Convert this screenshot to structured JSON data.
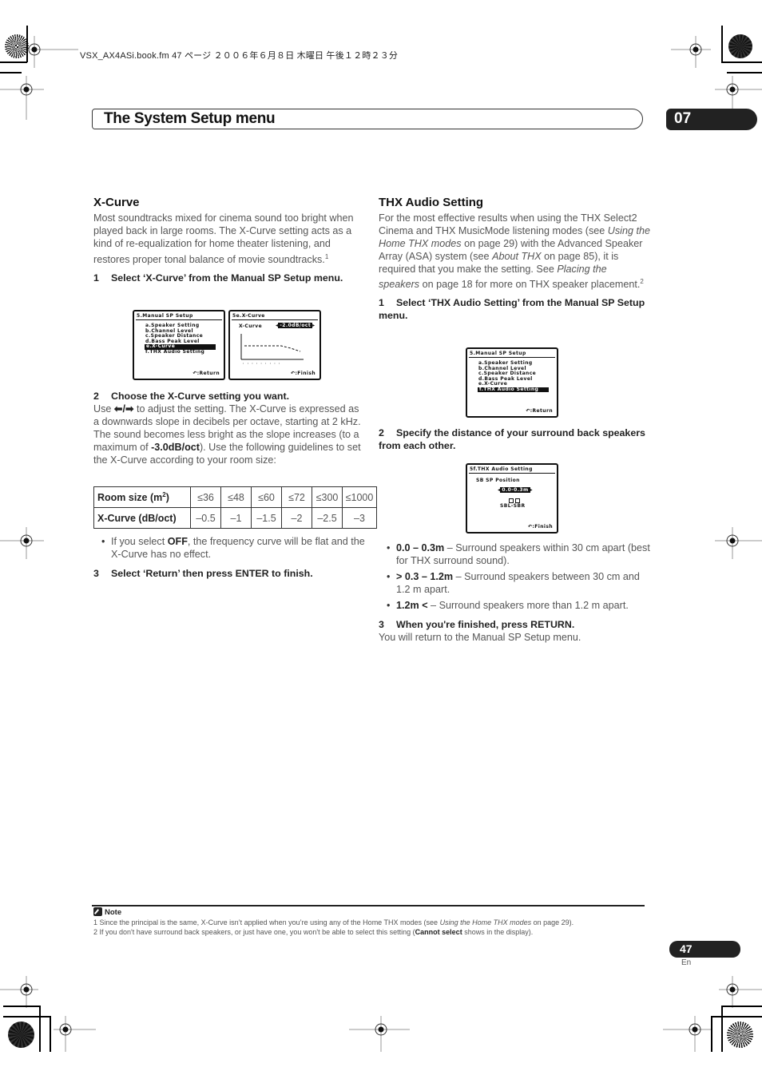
{
  "header": {
    "file_meta": "VSX_AX4ASi.book.fm  47 ページ  ２００６年６月８日  木曜日  午後１２時２３分",
    "section_title": "The System Setup menu",
    "chapter_number": "07"
  },
  "left_column": {
    "heading": "X-Curve",
    "intro": "Most soundtracks mixed for cinema sound too bright when played back in large rooms. The X-Curve setting acts as a kind of re-equalization for home theater listening, and restores proper tonal balance of movie soundtracks.",
    "intro_footnote": "1",
    "step1": {
      "num": "1",
      "text": "Select ‘X-Curve’ from the Manual SP Setup menu."
    },
    "screen_menu": {
      "title": "5.Manual  SP  Setup",
      "items": [
        "a.Speaker  Setting",
        "b.Channel  Level",
        "c.Speaker  Distance",
        "d.Bass  Peak  Level",
        "e.X-Curve",
        "f.THX  Audio  Setting"
      ],
      "selected_index": 4,
      "footer": "↶:Return"
    },
    "screen_xcurve": {
      "title": "5e.X-Curve",
      "label": "X-Curve",
      "value": "-2.0dB/oct",
      "footer": "↶:Finish"
    },
    "step2": {
      "num": "2",
      "text": "Choose the X-Curve setting you want."
    },
    "step2_body": {
      "use": "Use",
      "arrows": "⬅/➡",
      "rest1": " to adjust the setting. The X-Curve is expressed as a downwards slope in decibels per octave, starting at 2 kHz. The sound becomes less bright as the slope increases (to a maximum of ",
      "max": "-3.0dB/oct",
      "rest2": "). Use the following guidelines to set the X-Curve according to your room size:"
    },
    "table": {
      "row1_header": "Room size (m",
      "row1_header_sup": "2",
      "row1_header_end": ")",
      "room_sizes": [
        "≤36",
        "≤48",
        "≤60",
        "≤72",
        "≤300",
        "≤1000"
      ],
      "row2_header": "X-Curve (dB/oct)",
      "xcurve_values": [
        "–0.5",
        "–1",
        "–1.5",
        "–2",
        "–2.5",
        "–3"
      ]
    },
    "bullet_off": {
      "pre": "If you select ",
      "bold": "OFF",
      "post": ", the frequency curve will be flat and the X-Curve has no effect."
    },
    "step3": {
      "num": "3",
      "text": "Select ‘Return’ then press ENTER to finish."
    }
  },
  "right_column": {
    "heading": "THX Audio Setting",
    "intro": {
      "p1": "For the most effective results when using the THX Select2 Cinema and THX MusicMode listening modes (see ",
      "i1": "Using the Home THX modes",
      "p2": " on page 29) with the Advanced Speaker Array (ASA) system (see ",
      "i2": "About THX",
      "p3": " on page 85), it is required that you make the setting. See ",
      "i3": "Placing the speakers",
      "p4": " on page 18 for more on THX speaker placement.",
      "footnote": "2"
    },
    "step1": {
      "num": "1",
      "text": "Select ‘THX Audio Setting’ from the Manual SP Setup menu."
    },
    "screen_menu": {
      "title": "5.Manual  SP  Setup",
      "items": [
        "a.Speaker  Setting",
        "b.Channel  Level",
        "c.Speaker  Distance",
        "d.Bass  Peak  Level",
        "e.X-Curve",
        "f.THX  Audio  Setting"
      ],
      "selected_index": 5,
      "footer": "↶:Return"
    },
    "step2": {
      "num": "2",
      "text": "Specify the distance of your surround back speakers from each other."
    },
    "screen_thx": {
      "title": "5f.THX  Audio  Setting",
      "label": "SB  SP  Position",
      "value": "0.0-0.3m",
      "speakers": "SBL-SBR",
      "footer": "↶:Finish"
    },
    "bullets": [
      {
        "bold": "0.0 – 0.3m",
        "text": " – Surround speakers within 30 cm apart (best for THX surround sound)."
      },
      {
        "bold": "> 0.3 – 1.2m",
        "text": " – Surround speakers between 30 cm and 1.2 m apart."
      },
      {
        "bold": "1.2m <",
        "text": " – Surround speakers more than 1.2 m apart."
      }
    ],
    "step3": {
      "num": "3",
      "text": "When you're finished, press RETURN."
    },
    "step3_body": "You will return to the Manual SP Setup menu."
  },
  "notes": {
    "heading": "Note",
    "n1": {
      "pre": "1  Since the principal is the same, X-Curve isn’t applied when you’re using any of the Home THX modes (see ",
      "ital": "Using the Home THX modes",
      "post": " on page 29)."
    },
    "n2": {
      "pre": "2  If you don't have surround back speakers, or just have one, you won't be able to select this setting (",
      "bold": "Cannot select",
      "post": " shows in the display)."
    }
  },
  "footer": {
    "page_number": "47",
    "language": "En"
  }
}
